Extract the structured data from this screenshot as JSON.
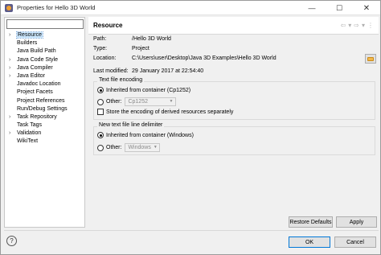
{
  "window": {
    "title": "Properties for Hello 3D World",
    "controls": {
      "minimize": "—",
      "maximize": "☐",
      "close": "✕"
    }
  },
  "sidebar": {
    "filter_value": "",
    "items": [
      {
        "label": "Resource",
        "expandable": true,
        "selected": true
      },
      {
        "label": "Builders",
        "expandable": false
      },
      {
        "label": "Java Build Path",
        "expandable": false
      },
      {
        "label": "Java Code Style",
        "expandable": true
      },
      {
        "label": "Java Compiler",
        "expandable": true
      },
      {
        "label": "Java Editor",
        "expandable": true
      },
      {
        "label": "Javadoc Location",
        "expandable": false
      },
      {
        "label": "Project Facets",
        "expandable": false
      },
      {
        "label": "Project References",
        "expandable": false
      },
      {
        "label": "Run/Debug Settings",
        "expandable": false
      },
      {
        "label": "Task Repository",
        "expandable": true
      },
      {
        "label": "Task Tags",
        "expandable": false
      },
      {
        "label": "Validation",
        "expandable": true
      },
      {
        "label": "WikiText",
        "expandable": false
      }
    ]
  },
  "header": {
    "title": "Resource",
    "nav_icons": [
      "back-arrow-icon",
      "back-dropdown-icon",
      "forward-arrow-icon",
      "forward-dropdown-icon",
      "view-menu-icon"
    ]
  },
  "info": {
    "path_label": "Path:",
    "path_value": "/Hello 3D World",
    "type_label": "Type:",
    "type_value": "Project",
    "location_label": "Location:",
    "location_value": "C:\\Users\\user\\Desktop\\Java 3D Examples\\Hello 3D World",
    "modified_label": "Last modified:",
    "modified_value": "29 January 2017 at 22:54:40"
  },
  "encoding": {
    "group_title": "Text file encoding",
    "inherited_label": "Inherited from container (Cp1252)",
    "other_label": "Other:",
    "other_value": "Cp1252",
    "store_derived_label": "Store the encoding of derived resources separately"
  },
  "delimiter": {
    "group_title": "New text file line delimiter",
    "inherited_label": "Inherited from container (Windows)",
    "other_label": "Other:",
    "other_value": "Windows"
  },
  "buttons": {
    "restore_defaults": "Restore Defaults",
    "apply": "Apply",
    "ok": "OK",
    "cancel": "Cancel"
  },
  "colors": {
    "selection": "#cce8ff",
    "accent": "#0078d7"
  }
}
